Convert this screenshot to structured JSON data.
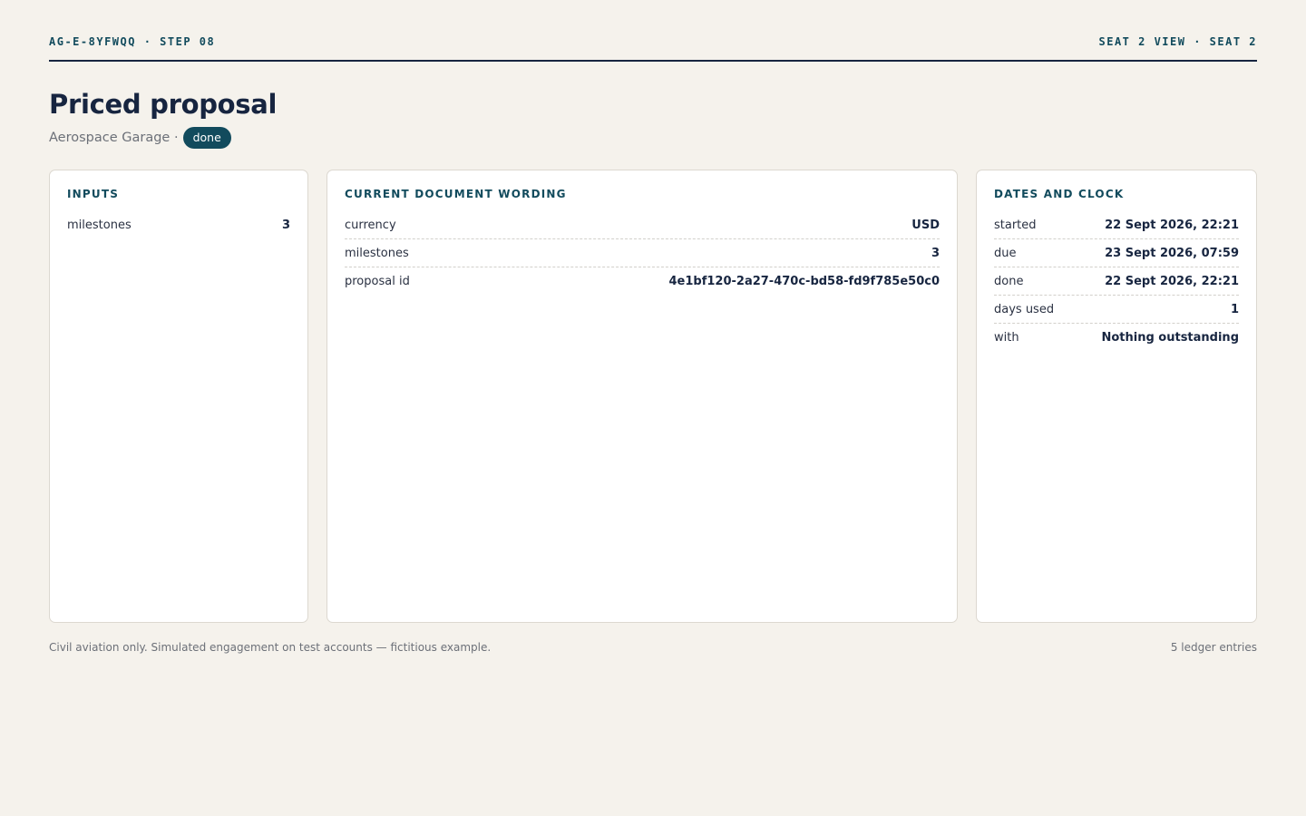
{
  "header": {
    "left": "AG-E-8YFWQQ · STEP 08",
    "right": "SEAT 2 VIEW · SEAT 2"
  },
  "title": "Priced proposal",
  "subtitle": {
    "org": "Aerospace Garage ·",
    "status": "done"
  },
  "inputs": {
    "title": "INPUTS",
    "rows": [
      {
        "key": "milestones",
        "value": "3"
      }
    ]
  },
  "wording": {
    "title": "CURRENT DOCUMENT WORDING",
    "rows": [
      {
        "key": "currency",
        "value": "USD"
      },
      {
        "key": "milestones",
        "value": "3"
      },
      {
        "key": "proposal id",
        "value": "4e1bf120-2a27-470c-bd58-fd9f785e50c0"
      }
    ]
  },
  "dates": {
    "title": "DATES AND CLOCK",
    "rows": [
      {
        "key": "started",
        "value": "22 Sept 2026, 22:21"
      },
      {
        "key": "due",
        "value": "23 Sept 2026, 07:59"
      },
      {
        "key": "done",
        "value": "22 Sept 2026, 22:21"
      },
      {
        "key": "days used",
        "value": "1"
      },
      {
        "key": "with",
        "value": "Nothing outstanding"
      }
    ]
  },
  "footer": {
    "note": "Civil aviation only. Simulated engagement on test accounts — fictitious example.",
    "count": "5 ledger entries"
  },
  "colors": {
    "background": "#f5f2ec",
    "accent": "#124b5d",
    "ink": "#172540"
  }
}
